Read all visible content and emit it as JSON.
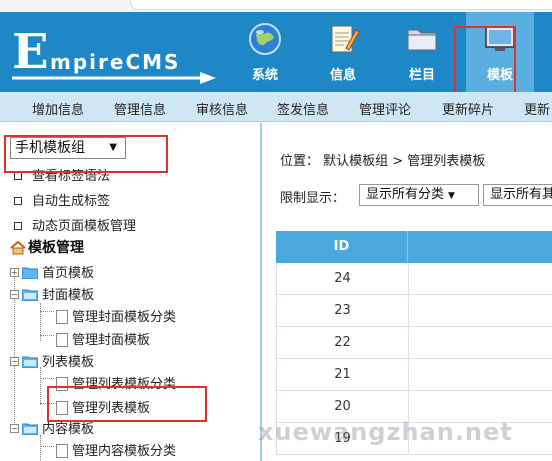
{
  "header": {
    "logo_big": "E",
    "logo_rest": "mpireCMS",
    "nav": [
      {
        "label": "系统",
        "icon": "globe-icon"
      },
      {
        "label": "信息",
        "icon": "notepad-icon"
      },
      {
        "label": "栏目",
        "icon": "folder-icon"
      },
      {
        "label": "模板",
        "icon": "monitor-icon",
        "active": true
      }
    ]
  },
  "subnav": {
    "items": [
      "增加信息",
      "管理信息",
      "审核信息",
      "签发信息",
      "管理评论",
      "更新碎片",
      "更新"
    ]
  },
  "sidebar": {
    "group_select": "手机模板组",
    "links": [
      "查看标签语法",
      "自动生成标签",
      "动态页面模板管理"
    ],
    "tree_title": "模板管理",
    "tree": {
      "home_tpl": "首页模板",
      "cover_tpl": "封面模板",
      "cover_manage_class": "管理封面模板分类",
      "cover_manage": "管理封面模板",
      "list_tpl": "列表模板",
      "list_manage_class": "管理列表模板分类",
      "list_manage": "管理列表模板",
      "content_tpl": "内容模板",
      "content_manage_class": "管理内容模板分类"
    }
  },
  "main": {
    "breadcrumb": "位置： 默认模板组 > 管理列表模板",
    "filter_label": "限制显示：",
    "filter_select_1": "显示所有分类",
    "filter_select_2": "显示所有其",
    "table": {
      "header_id": "ID",
      "ids": [
        "24",
        "23",
        "22",
        "21",
        "20",
        "19"
      ]
    }
  },
  "watermark": "xuewangzhan.net",
  "colors": {
    "header_bg": "#1e88c7",
    "subnav_bg": "#cfe6f5",
    "table_header_bg": "#4aa8dc",
    "highlight_red": "#e03030"
  }
}
